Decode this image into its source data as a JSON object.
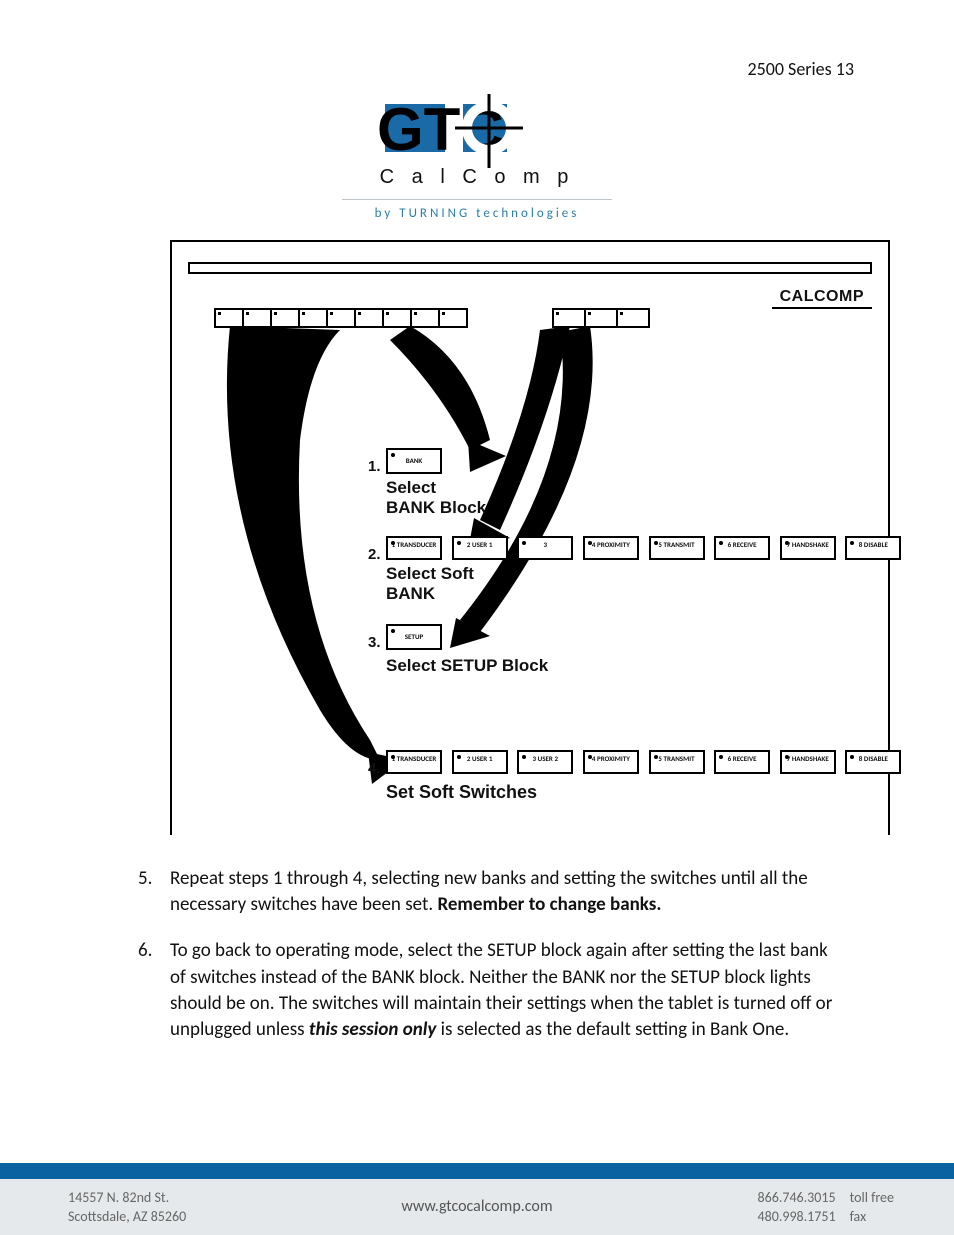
{
  "header": {
    "pagenum": "2500 Series 13"
  },
  "logo": {
    "sub": "C a l C o m p",
    "byline": "by TURNING technologies"
  },
  "diagram": {
    "badge": "CALCOMP",
    "step1": {
      "num": "1.",
      "label_a": "Select",
      "label_b": "BANK Block",
      "box": "BANK"
    },
    "step2": {
      "num": "2.",
      "label_a": "Select Soft",
      "label_b": "BANK",
      "cells": [
        "1 TRANSDUCER",
        "2 USER 1",
        "3",
        "4 PROXIMITY",
        "5 TRANSMIT",
        "6 RECEIVE",
        "7 HANDSHAKE",
        "8 DISABLE"
      ]
    },
    "step3": {
      "num": "3.",
      "label": "Select SETUP Block",
      "box": "SETUP"
    },
    "step4": {
      "num": "4.",
      "label": "Set Soft Switches",
      "cells": [
        "1 TRANSDUCER",
        "2 USER 1",
        "3 USER 2",
        "4 PROXIMITY",
        "5 TRANSMIT",
        "6 RECEIVE",
        "7 HANDSHAKE",
        "8 DISABLE"
      ]
    }
  },
  "body": {
    "item5": {
      "num": "5.",
      "text_a": "Repeat steps 1 through 4, selecting new banks and setting the switches until all the necessary switches have been set.  ",
      "text_b": "Remember to change banks."
    },
    "item6": {
      "num": "6.",
      "text_a": "To go back to operating mode, select the SETUP block again after setting the last bank of switches instead of the BANK block.  Neither the BANK nor the SETUP block lights should be on.  The switches will maintain their settings when the tablet is turned off or unplugged unless ",
      "text_b": "this session only",
      "text_c": " is selected as the default setting in Bank One."
    }
  },
  "footer": {
    "addr1": "14557 N. 82nd St.",
    "addr2": "Scottsdale, AZ 85260",
    "url": "www.gtcocalcomp.com",
    "phone1": "866.746.3015",
    "phone1_lbl": "toll free",
    "phone2": "480.998.1751",
    "phone2_lbl": "fax"
  }
}
